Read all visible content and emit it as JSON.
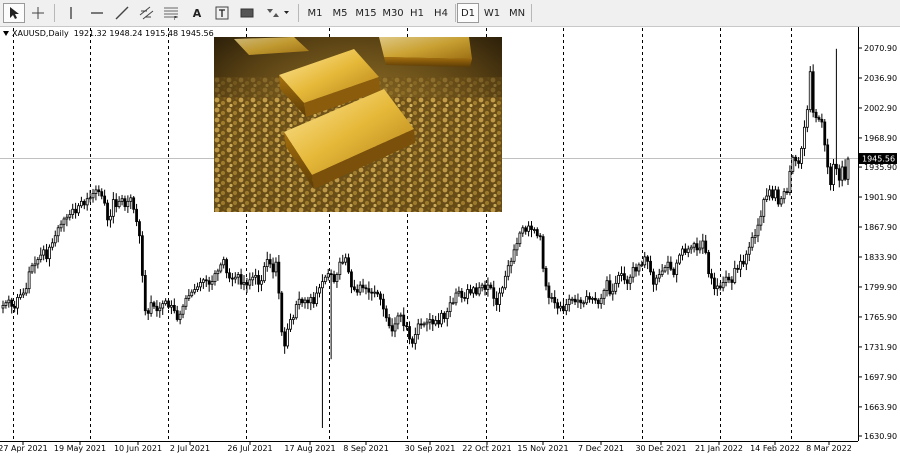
{
  "toolbar": {
    "tools": [
      {
        "name": "cursor-tool",
        "icon": "arrow-cursor-icon"
      },
      {
        "name": "crosshair-tool",
        "icon": "crosshair-icon"
      },
      {
        "name": "vertical-line-tool",
        "icon": "vertical-line-icon"
      },
      {
        "name": "horizontal-line-tool",
        "icon": "horizontal-line-icon"
      },
      {
        "name": "trendline-tool",
        "icon": "trendline-icon"
      },
      {
        "name": "channel-tool",
        "icon": "channel-icon"
      },
      {
        "name": "fibonacci-tool",
        "icon": "fibonacci-icon"
      },
      {
        "name": "text-tool",
        "icon": "text-icon",
        "label": "A"
      },
      {
        "name": "text-label-tool",
        "icon": "text-label-icon"
      },
      {
        "name": "rectangle-tool",
        "icon": "rectangle-icon"
      },
      {
        "name": "arrows-tool",
        "icon": "arrows-icon"
      }
    ],
    "timeframes": [
      "M1",
      "M5",
      "M15",
      "M30",
      "H1",
      "H4",
      "D1",
      "W1",
      "MN"
    ],
    "active_timeframe": "D1"
  },
  "legend": {
    "symbol": "XAUUSD,Daily",
    "ohlc": "1921.32 1948.24 1915.48 1945.56"
  },
  "photo": {
    "icon": "gold-bars-photo"
  },
  "colors": {
    "candle": "#000000",
    "grid": "#000000",
    "price_line": "#c0c0c0",
    "background": "#ffffff",
    "label_bg": "#000000",
    "label_text": "#ffffff"
  },
  "chart_data": {
    "type": "candlestick",
    "symbol": "XAUUSD",
    "timeframe": "Daily",
    "y_ticks": [
      "2070.90",
      "2036.90",
      "2002.90",
      "1968.90",
      "1935.90",
      "1901.90",
      "1867.90",
      "1833.90",
      "1799.90",
      "1765.90",
      "1731.90",
      "1697.90",
      "1663.90",
      "1630.90"
    ],
    "x_ticks": [
      "27 Apr 2021",
      "19 May 2021",
      "10 Jun 2021",
      "2 Jul 2021",
      "26 Jul 2021",
      "17 Aug 2021",
      "8 Sep 2021",
      "30 Sep 2021",
      "22 Oct 2021",
      "15 Nov 2021",
      "7 Dec 2021",
      "30 Dec 2021",
      "21 Jan 2022",
      "14 Feb 2022",
      "8 Mar 2022"
    ],
    "ylim": [
      1625,
      2082
    ],
    "current_price": "1945.56",
    "grid": "vertical dashed at date ticks",
    "closes": [
      1779,
      1782,
      1785,
      1778,
      1776,
      1788,
      1791,
      1793,
      1798,
      1817,
      1824,
      1826,
      1831,
      1836,
      1842,
      1832,
      1845,
      1850,
      1858,
      1867,
      1871,
      1877,
      1879,
      1882,
      1888,
      1884,
      1892,
      1897,
      1893,
      1900,
      1901,
      1906,
      1910,
      1908,
      1903,
      1895,
      1876,
      1880,
      1899,
      1891,
      1897,
      1900,
      1891,
      1897,
      1901,
      1888,
      1874,
      1858,
      1813,
      1773,
      1770,
      1782,
      1778,
      1773,
      1776,
      1781,
      1784,
      1777,
      1779,
      1773,
      1763,
      1769,
      1778,
      1787,
      1790,
      1794,
      1797,
      1800,
      1805,
      1808,
      1807,
      1803,
      1806,
      1815,
      1818,
      1825,
      1831,
      1816,
      1810,
      1809,
      1811,
      1814,
      1803,
      1805,
      1802,
      1808,
      1811,
      1813,
      1803,
      1807,
      1823,
      1831,
      1826,
      1817,
      1828,
      1793,
      1749,
      1733,
      1752,
      1763,
      1765,
      1780,
      1786,
      1782,
      1785,
      1782,
      1788,
      1781,
      1793,
      1799,
      1806,
      1811,
      1815,
      1814,
      1806,
      1814,
      1828,
      1828,
      1833,
      1817,
      1800,
      1797,
      1794,
      1802,
      1799,
      1798,
      1794,
      1793,
      1794,
      1792,
      1786,
      1775,
      1765,
      1756,
      1750,
      1758,
      1767,
      1768,
      1756,
      1755,
      1741,
      1736,
      1746,
      1758,
      1757,
      1758,
      1760,
      1763,
      1758,
      1762,
      1758,
      1770,
      1764,
      1772,
      1782,
      1782,
      1793,
      1795,
      1788,
      1787,
      1797,
      1793,
      1799,
      1792,
      1799,
      1802,
      1797,
      1802,
      1799,
      1787,
      1780,
      1793,
      1799,
      1812,
      1824,
      1829,
      1842,
      1849,
      1861,
      1867,
      1863,
      1869,
      1865,
      1865,
      1858,
      1857,
      1821,
      1801,
      1788,
      1788,
      1782,
      1776,
      1778,
      1773,
      1780,
      1786,
      1786,
      1783,
      1785,
      1782,
      1782,
      1789,
      1786,
      1787,
      1785,
      1781,
      1787,
      1796,
      1807,
      1792,
      1795,
      1804,
      1813,
      1815,
      1808,
      1804,
      1811,
      1822,
      1818,
      1825,
      1825,
      1834,
      1829,
      1817,
      1803,
      1810,
      1814,
      1818,
      1822,
      1828,
      1820,
      1814,
      1827,
      1836,
      1843,
      1839,
      1843,
      1845,
      1849,
      1842,
      1844,
      1852,
      1839,
      1815,
      1810,
      1798,
      1801,
      1799,
      1805,
      1811,
      1808,
      1805,
      1821,
      1820,
      1829,
      1826,
      1837,
      1845,
      1856,
      1858,
      1870,
      1880,
      1899,
      1903,
      1910,
      1901,
      1910,
      1894,
      1900,
      1908,
      1907,
      1931,
      1947,
      1943,
      1940,
      1957,
      1981,
      2001,
      2044,
      1998,
      1992,
      1990,
      1987,
      1961,
      1936,
      1916,
      1939,
      1934,
      1921,
      1936,
      1922,
      1945
    ]
  }
}
